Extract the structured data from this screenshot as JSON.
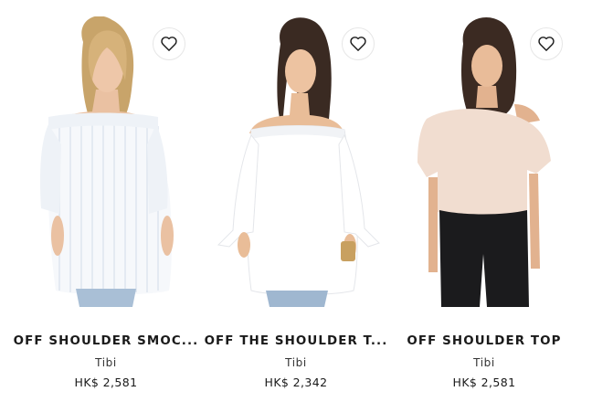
{
  "products": [
    {
      "name": "OFF SHOULDER SMOC...",
      "brand": "Tibi",
      "price": "HK$ 2,581",
      "wishlist_icon": "heart-outline-icon"
    },
    {
      "name": "OFF THE SHOULDER T...",
      "brand": "Tibi",
      "price": "HK$ 2,342",
      "wishlist_icon": "heart-outline-icon"
    },
    {
      "name": "OFF SHOULDER TOP",
      "brand": "Tibi",
      "price": "HK$ 2,581",
      "wishlist_icon": "heart-outline-icon"
    }
  ],
  "colors": {
    "text": "#1a1a1a",
    "skin": "#e9c0a3",
    "blouse_white": "#f8f9fb",
    "blouse_stripe": "#dde4ee",
    "top_blush": "#f1ddd0",
    "denim": "#9fb7d0",
    "black_jeans": "#1b1b1d"
  }
}
